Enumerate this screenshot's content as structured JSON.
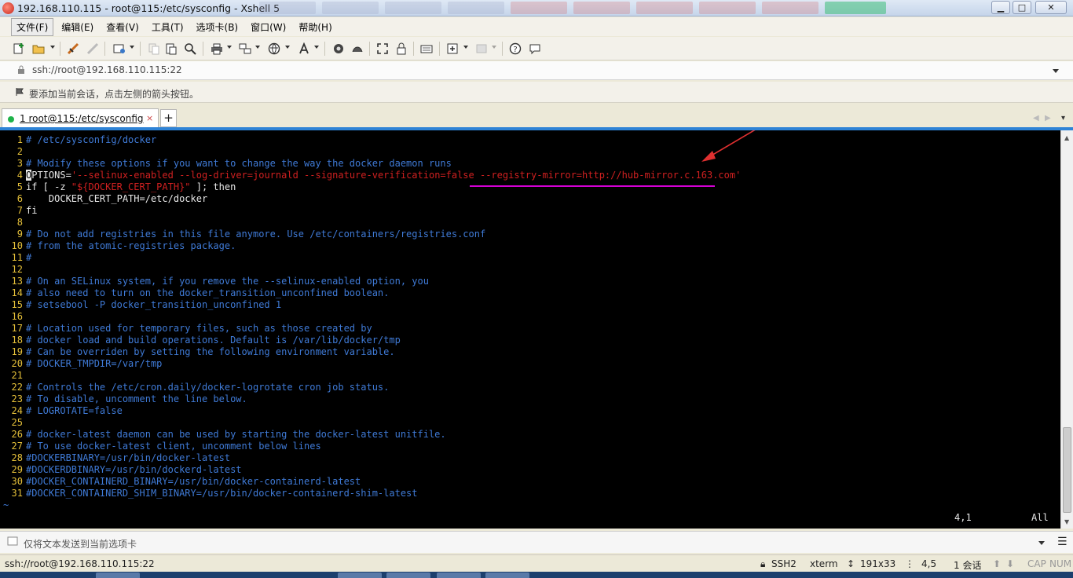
{
  "window": {
    "title": "192.168.110.115 - root@115:/etc/sysconfig - Xshell 5",
    "minimize": "▁",
    "maximize": "□",
    "close": "✕"
  },
  "menu": [
    "文件(F)",
    "编辑(E)",
    "查看(V)",
    "工具(T)",
    "选项卡(B)",
    "窗口(W)",
    "帮助(H)"
  ],
  "address": {
    "value": "ssh://root@192.168.110.115:22"
  },
  "hint": {
    "text": "要添加当前会话，点击左侧的箭头按钮。"
  },
  "tabs": {
    "active_label": "1 root@115:/etc/sysconfig",
    "close_glyph": "×",
    "add_glyph": "+"
  },
  "terminal": {
    "lines": [
      {
        "n": "1",
        "text": "# /etc/sysconfig/docker"
      },
      {
        "n": "2",
        "text": ""
      },
      {
        "n": "3",
        "text": "# Modify these options if you want to change the way the docker daemon runs"
      },
      {
        "n": "4",
        "prefix_cursor": "O",
        "prefix": "PTIONS=",
        "value": "'--selinux-enabled --log-driver=journald --signature-verification=false --registry-mirror=http://hub-mirror.c.163.com'"
      },
      {
        "n": "5",
        "prefix": "if [ -z ",
        "value": "\"${DOCKER_CERT_PATH}\"",
        "suffix": " ]; then"
      },
      {
        "n": "6",
        "text": "    DOCKER_CERT_PATH=/etc/docker"
      },
      {
        "n": "7",
        "text": "fi"
      },
      {
        "n": "8",
        "text": ""
      },
      {
        "n": "9",
        "text": "# Do not add registries in this file anymore. Use /etc/containers/registries.conf"
      },
      {
        "n": "10",
        "text": "# from the atomic-registries package."
      },
      {
        "n": "11",
        "text": "#"
      },
      {
        "n": "12",
        "text": ""
      },
      {
        "n": "13",
        "text": "# On an SELinux system, if you remove the --selinux-enabled option, you"
      },
      {
        "n": "14",
        "text": "# also need to turn on the docker_transition_unconfined boolean."
      },
      {
        "n": "15",
        "text": "# setsebool -P docker_transition_unconfined 1"
      },
      {
        "n": "16",
        "text": ""
      },
      {
        "n": "17",
        "text": "# Location used for temporary files, such as those created by"
      },
      {
        "n": "18",
        "text": "# docker load and build operations. Default is /var/lib/docker/tmp"
      },
      {
        "n": "19",
        "text": "# Can be overriden by setting the following environment variable."
      },
      {
        "n": "20",
        "text": "# DOCKER_TMPDIR=/var/tmp"
      },
      {
        "n": "21",
        "text": ""
      },
      {
        "n": "22",
        "text": "# Controls the /etc/cron.daily/docker-logrotate cron job status."
      },
      {
        "n": "23",
        "text": "# To disable, uncomment the line below."
      },
      {
        "n": "24",
        "text": "# LOGROTATE=false"
      },
      {
        "n": "25",
        "text": ""
      },
      {
        "n": "26",
        "text": "# docker-latest daemon can be used by starting the docker-latest unitfile."
      },
      {
        "n": "27",
        "text": "# To use docker-latest client, uncomment below lines"
      },
      {
        "n": "28",
        "text": "#DOCKERBINARY=/usr/bin/docker-latest"
      },
      {
        "n": "29",
        "text": "#DOCKERDBINARY=/usr/bin/dockerd-latest"
      },
      {
        "n": "30",
        "text": "#DOCKER_CONTAINERD_BINARY=/usr/bin/docker-containerd-latest"
      },
      {
        "n": "31",
        "text": "#DOCKER_CONTAINERD_SHIM_BINARY=/usr/bin/docker-containerd-shim-latest"
      }
    ],
    "tilde": "~",
    "cursor_pos": "4,1",
    "view": "All"
  },
  "compose": {
    "placeholder": "仅将文本发送到当前选项卡"
  },
  "status": {
    "address": "ssh://root@192.168.110.115:22",
    "protocol": "SSH2",
    "term": "xterm",
    "size": "191x33",
    "cursor": "4,5",
    "sessions": "1 会话",
    "caps": "CAP",
    "num": "NUM"
  },
  "colors": {
    "terminal_bg": "#000000",
    "comment": "#3f7ad6",
    "string": "#cf2020",
    "line_number": "#e5c039",
    "tab_accent": "#2e83d6",
    "annotation_arrow": "#e03030"
  }
}
